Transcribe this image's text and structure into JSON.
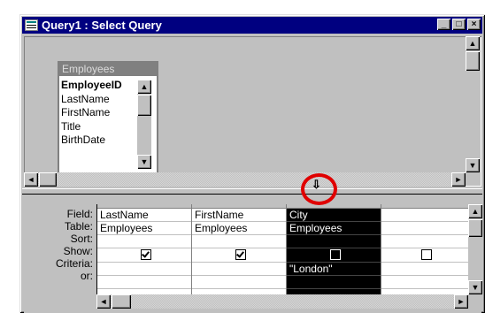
{
  "window": {
    "title": "Query1 : Select Query",
    "buttons": {
      "minimize": "_",
      "maximize": "□",
      "close": "×"
    }
  },
  "table": {
    "name": "Employees",
    "fields": [
      "EmployeeID",
      "LastName",
      "FirstName",
      "Title",
      "BirthDate"
    ],
    "primary_key": "EmployeeID"
  },
  "grid": {
    "row_labels": [
      "Field:",
      "Table:",
      "Sort:",
      "Show:",
      "Criteria:",
      "or:"
    ],
    "columns": [
      {
        "field": "LastName",
        "table": "Employees",
        "sort": "",
        "show": true,
        "criteria": "",
        "or": ""
      },
      {
        "field": "FirstName",
        "table": "Employees",
        "sort": "",
        "show": true,
        "criteria": "",
        "or": ""
      },
      {
        "field": "City",
        "table": "Employees",
        "sort": "",
        "show": false,
        "criteria": "\"London\"",
        "or": "",
        "selected": true
      },
      {
        "field": "",
        "table": "",
        "sort": "",
        "show": false,
        "criteria": "",
        "or": ""
      }
    ]
  },
  "colors": {
    "titlebar": "#000080",
    "selection": "#000000",
    "highlight_circle": "#e00000"
  },
  "icons": {
    "app": "query-icon",
    "column_selector": "down-arrow-icon"
  }
}
